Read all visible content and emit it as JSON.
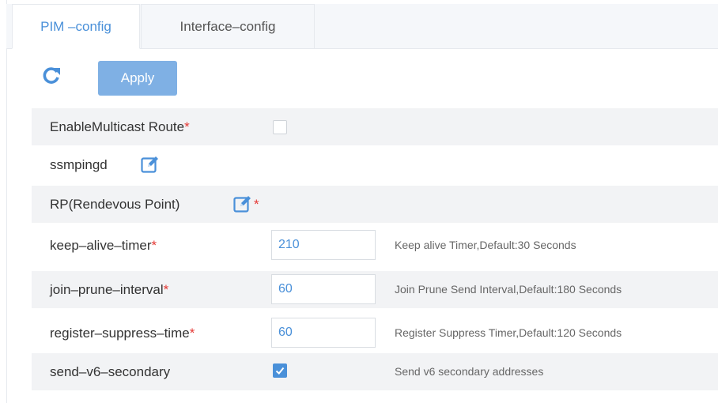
{
  "tabs": [
    {
      "label": "PIM –config",
      "active": true
    },
    {
      "label": "Interface–config",
      "active": false
    }
  ],
  "toolbar": {
    "refresh_icon": "refresh-icon",
    "apply_label": "Apply"
  },
  "colors": {
    "accent": "#4a90d9",
    "apply_button": "#7fb0e4",
    "required_star": "#e53935",
    "row_shade": "#f2f3f5"
  },
  "rows": [
    {
      "label": "EnableMulticast Route",
      "required": "*",
      "control": "checkbox",
      "checked": false
    },
    {
      "label": "ssmpingd",
      "required": "",
      "control": "edit-icon"
    },
    {
      "label": "RP(Rendevous Point)",
      "required": "*",
      "control": "edit-icon"
    },
    {
      "label": "keep–alive–timer",
      "required": "*",
      "control": "input",
      "value": "210",
      "hint": "Keep alive Timer,Default:30 Seconds"
    },
    {
      "label": "join–prune–interval",
      "required": "*",
      "control": "input",
      "value": "60",
      "hint": "Join Prune Send Interval,Default:180 Seconds"
    },
    {
      "label": "register–suppress–time",
      "required": "*",
      "control": "input",
      "value": "60",
      "hint": "Register Suppress Timer,Default:120 Seconds"
    },
    {
      "label": "send–v6–secondary",
      "required": "",
      "control": "checkbox",
      "checked": true,
      "hint": "Send v6 secondary addresses"
    }
  ]
}
